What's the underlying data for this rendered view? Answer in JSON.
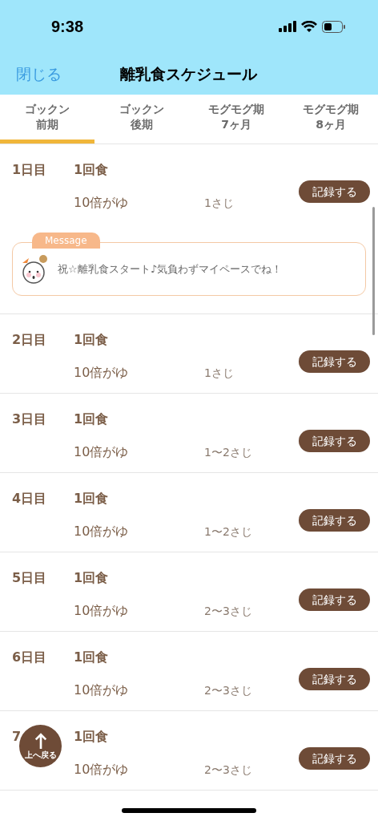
{
  "status_bar": {
    "time": "9:38"
  },
  "nav": {
    "close": "閉じる",
    "title": "離乳食スケジュール"
  },
  "tabs": [
    {
      "line1": "ゴックン",
      "line2": "前期",
      "selected": true
    },
    {
      "line1": "ゴックン",
      "line2": "後期",
      "selected": false
    },
    {
      "line1": "モグモグ期",
      "line2": "7ヶ月",
      "selected": false
    },
    {
      "line1": "モグモグ期",
      "line2": "8ヶ月",
      "selected": false
    }
  ],
  "days": [
    {
      "day": "1日目",
      "meal": "1回食",
      "food": "10倍がゆ",
      "amount": "1さじ",
      "button": "記録する",
      "message": {
        "ribbon": "Message",
        "text": "祝☆離乳食スタート♪気負わずマイペースでね！"
      }
    },
    {
      "day": "2日目",
      "meal": "1回食",
      "food": "10倍がゆ",
      "amount": "1さじ",
      "button": "記録する"
    },
    {
      "day": "3日目",
      "meal": "1回食",
      "food": "10倍がゆ",
      "amount": "1〜2さじ",
      "button": "記録する"
    },
    {
      "day": "4日目",
      "meal": "1回食",
      "food": "10倍がゆ",
      "amount": "1〜2さじ",
      "button": "記録する"
    },
    {
      "day": "5日目",
      "meal": "1回食",
      "food": "10倍がゆ",
      "amount": "2〜3さじ",
      "button": "記録する"
    },
    {
      "day": "6日目",
      "meal": "1回食",
      "food": "10倍がゆ",
      "amount": "2〜3さじ",
      "button": "記録する"
    },
    {
      "day": "7",
      "meal": "1回食",
      "food": "10倍がゆ",
      "amount": "2〜3さじ",
      "button": "記録する"
    }
  ],
  "back_to_top": {
    "label": "上へ戻る"
  }
}
